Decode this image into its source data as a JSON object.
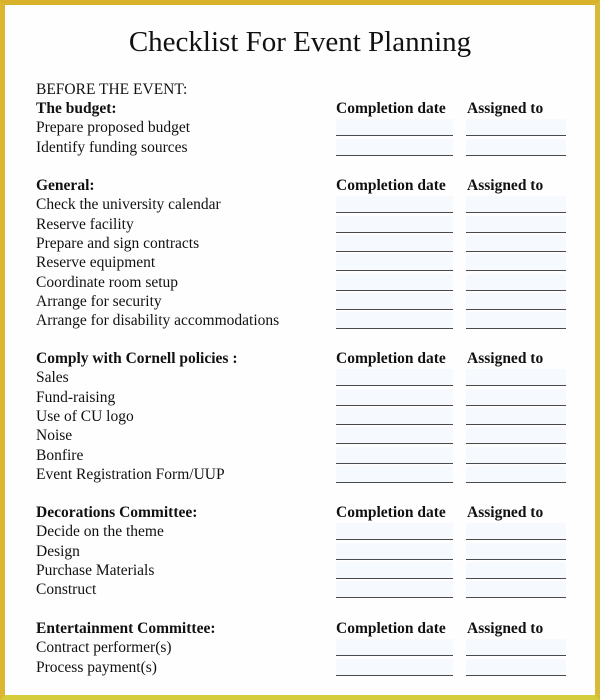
{
  "document": {
    "title": "Checklist For Event Planning",
    "phase_label": "BEFORE THE EVENT:",
    "column_headers": {
      "completion": "Completion date",
      "assigned": "Assigned to"
    },
    "colors": {
      "frame": "#d8b22a",
      "field_background": "#f6f9fd"
    },
    "sections": [
      {
        "heading": "The budget:",
        "items": [
          "Prepare proposed budget",
          "Identify funding sources"
        ]
      },
      {
        "heading": "General:",
        "items": [
          "Check the university calendar",
          "Reserve facility",
          "Prepare and sign contracts",
          "Reserve equipment",
          "Coordinate room setup",
          "Arrange for security",
          "Arrange for disability accommodations"
        ]
      },
      {
        "heading": "Comply with Cornell policies :",
        "items": [
          "Sales",
          "Fund-raising",
          "Use of CU logo",
          "Noise",
          "Bonfire",
          "Event Registration Form/UUP"
        ]
      },
      {
        "heading": "Decorations Committee:",
        "items": [
          "Decide on the theme",
          "Design",
          "Purchase Materials",
          "Construct"
        ]
      },
      {
        "heading": "Entertainment Committee:",
        "items": [
          "Contract performer(s)",
          "Process payment(s)"
        ]
      }
    ]
  }
}
